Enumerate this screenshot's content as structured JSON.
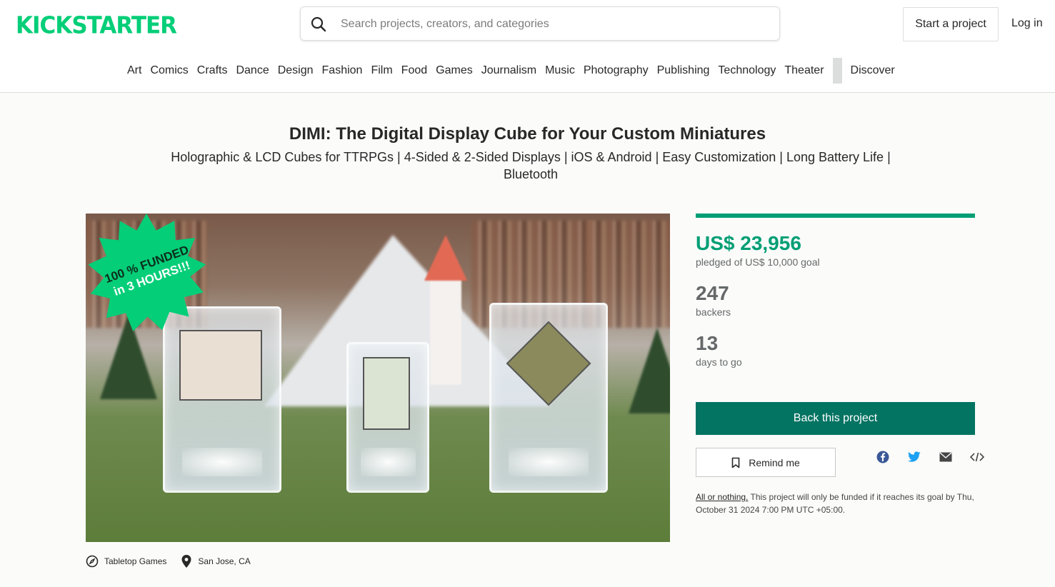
{
  "header": {
    "logo": "KICKSTARTER",
    "search_placeholder": "Search projects, creators, and categories",
    "start_project": "Start a project",
    "login": "Log in"
  },
  "categories": [
    "Art",
    "Comics",
    "Crafts",
    "Dance",
    "Design",
    "Fashion",
    "Film",
    "Food",
    "Games",
    "Journalism",
    "Music",
    "Photography",
    "Publishing",
    "Technology",
    "Theater"
  ],
  "discover": "Discover",
  "project": {
    "title": "DIMI: The Digital Display Cube for Your Custom Miniatures",
    "subtitle": "Holographic & LCD Cubes for TTRPGs | 4-Sided & 2-Sided Displays | iOS & Android | Easy Customization | Long Battery Life | Bluetooth",
    "badge_line1": "100 % FUNDED",
    "badge_line2": "in 3 HOURS!!!",
    "category": "Tabletop Games",
    "location": "San Jose, CA"
  },
  "stats": {
    "funded_fraction": 1.0,
    "pledged": "US$ 23,956",
    "pledged_sub": "pledged of US$ 10,000 goal",
    "backers": "247",
    "backers_label": "backers",
    "days": "13",
    "days_label": "days to go",
    "back_button": "Back this project",
    "remind_button": "Remind me",
    "aon_link": "All or nothing.",
    "aon_text": "This project will only be funded if it reaches its goal by Thu, October 31 2024 7:00 PM UTC +05:00."
  },
  "colors": {
    "brand": "#05ce78",
    "accent": "#009e74",
    "button": "#037362"
  },
  "share_icons": [
    "facebook-icon",
    "twitter-icon",
    "email-icon",
    "embed-icon"
  ]
}
